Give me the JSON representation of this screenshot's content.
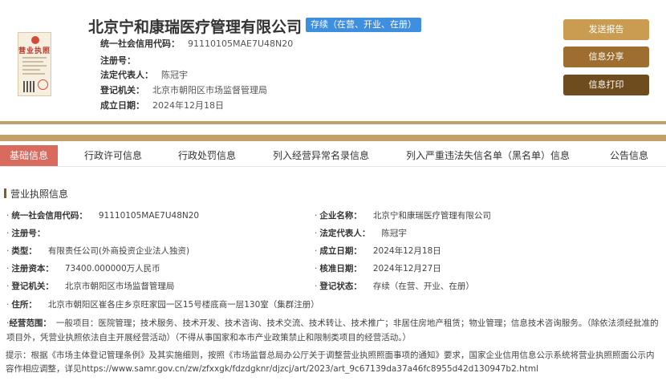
{
  "header": {
    "license_thumb_title": "营业执照",
    "company_name": "北京宁和康瑞医疗管理有限公司",
    "status": "存续（在营、开业、在册）",
    "rows": [
      {
        "label": "统一社会信用代码：",
        "value": "91110105MAE7U48N20"
      },
      {
        "label": "注册号：",
        "value": ""
      },
      {
        "label": "法定代表人：",
        "value": "陈冠宇"
      },
      {
        "label": "登记机关：",
        "value": "北京市朝阳区市场监督管理局"
      },
      {
        "label": "成立日期：",
        "value": "2024年12月18日"
      }
    ],
    "buttons": {
      "report": "发送报告",
      "share": "信息分享",
      "print": "信息打印"
    }
  },
  "tabs": [
    {
      "label": "基础信息",
      "active": true
    },
    {
      "label": "行政许可信息",
      "active": false
    },
    {
      "label": "行政处罚信息",
      "active": false
    },
    {
      "label": "列入经营异常名录信息",
      "active": false
    },
    {
      "label": "列入严重违法失信名单（黑名单）信息",
      "active": false
    },
    {
      "label": "公告信息",
      "active": false
    }
  ],
  "section": {
    "title": "营业执照信息",
    "left": [
      {
        "label": "统一社会信用代码：",
        "value": "91110105MAE7U48N20"
      },
      {
        "label": "注册号：",
        "value": ""
      },
      {
        "label": "类型：",
        "value": "有限责任公司(外商投资企业法人独资)"
      },
      {
        "label": "注册资本：",
        "value": "73400.000000万人民币"
      },
      {
        "label": "登记机关：",
        "value": "北京市朝阳区市场监督管理局"
      },
      {
        "label": "住所：",
        "value": "北京市朝阳区崔各庄乡京旺家园一区15号楼底商一层130室（集群注册）"
      }
    ],
    "right": [
      {
        "label": "企业名称：",
        "value": "北京宁和康瑞医疗管理有限公司"
      },
      {
        "label": "法定代表人：",
        "value": "陈冠宇"
      },
      {
        "label": "成立日期：",
        "value": "2024年12月18日"
      },
      {
        "label": "核准日期：",
        "value": "2024年12月27日"
      },
      {
        "label": "登记状态：",
        "value": "存续（在营、开业、在册）"
      }
    ],
    "scope_label": "经营范围：",
    "scope_value": "一般项目：医院管理；技术服务、技术开发、技术咨询、技术交流、技术转让、技术推广；非居住房地产租赁；物业管理；信息技术咨询服务。（除依法须经批准的项目外，凭营业执照依法自主开展经营活动）（不得从事国家和本市产业政策禁止和限制类项目的经营活动。）",
    "tip": "提示：根据《市场主体登记管理条例》及其实施细则，按照《市场监督总局办公厅关于调整营业执照照面事项的通知》要求，国家企业信用信息公示系统将营业执照照面公示内容作相应调整，详见https://www.samr.gov.cn/zw/zfxxgk/fdzdgknr/djzcj/art/2023/art_9c67139da37a46fc8955d42d130947b2.html"
  }
}
